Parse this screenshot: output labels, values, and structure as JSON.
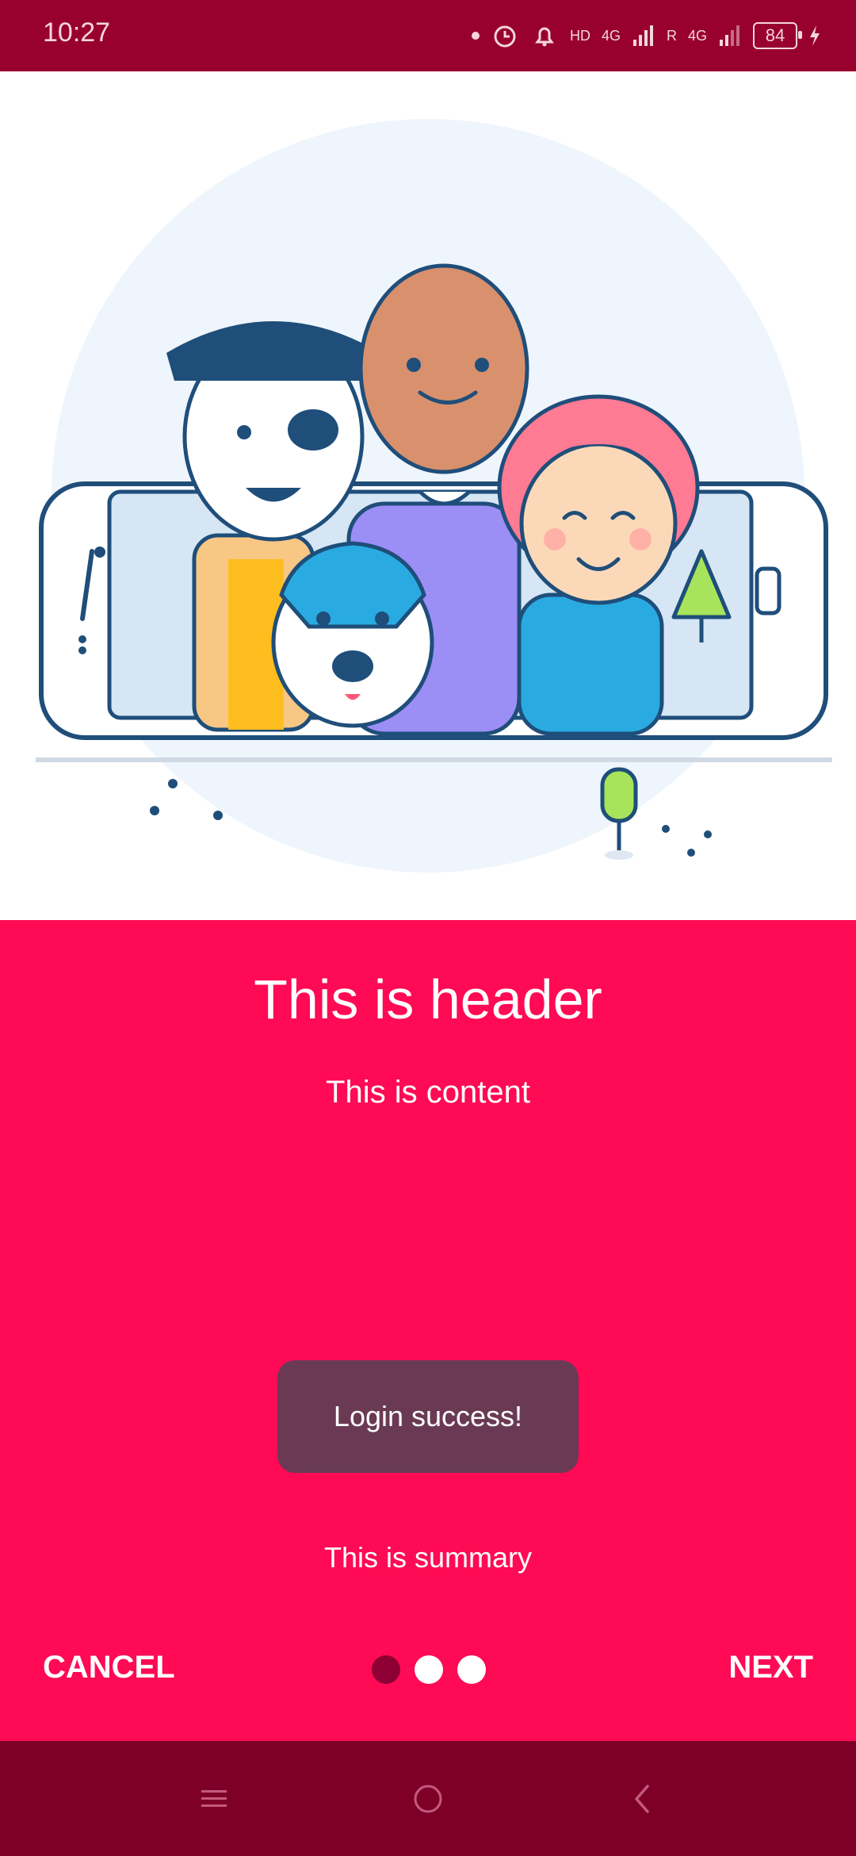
{
  "status_bar": {
    "time": "10:27",
    "battery": "84",
    "network_labels": [
      "4G",
      "HD",
      "R",
      "4G"
    ]
  },
  "illustration": {
    "icon": "people-with-dog-and-phone-illustration"
  },
  "panel": {
    "header": "This is header",
    "content": "This is content",
    "toast": "Login success!",
    "summary": "This is summary",
    "cancel_label": "CANCEL",
    "next_label": "NEXT",
    "page_indicator": {
      "total": 3,
      "current": 1
    }
  },
  "nav": {
    "menu_icon": "menu-icon",
    "home_icon": "home-circle-icon",
    "back_icon": "back-chevron-icon"
  },
  "colors": {
    "status_bar": "#98002e",
    "panel": "#ff0a54",
    "nav_bar": "#7e0029",
    "toast": "#6a3a55"
  }
}
